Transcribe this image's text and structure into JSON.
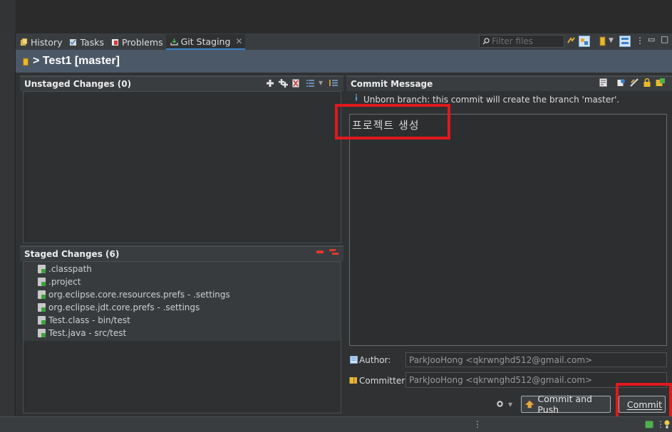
{
  "tabs": [
    {
      "label": "History",
      "icon": "history-icon"
    },
    {
      "label": "Tasks",
      "icon": "tasks-icon"
    },
    {
      "label": "Problems",
      "icon": "problems-icon"
    },
    {
      "label": "Git Staging",
      "icon": "git-staging-icon",
      "active": true
    }
  ],
  "filter": {
    "placeholder": "Filter files"
  },
  "repo": {
    "title": "> Test1 [master]"
  },
  "unstaged": {
    "title": "Unstaged Changes (0)"
  },
  "staged": {
    "title": "Staged Changes (6)",
    "files": [
      ".classpath",
      ".project",
      "org.eclipse.core.resources.prefs - .settings",
      "org.eclipse.jdt.core.prefs - .settings",
      "Test.class - bin/test",
      "Test.java - src/test"
    ]
  },
  "commit": {
    "title": "Commit Message",
    "info": "Unborn branch: this commit will create the branch 'master'.",
    "message": "프로젝트 생성",
    "author_label": "Author:",
    "author_value": "ParkJooHong <qkrwnghd512@gmail.com>",
    "committer_label": "Committer:",
    "committer_value": "ParkJooHong <qkrwnghd512@gmail.com>",
    "commit_push_label": "Commit and Push",
    "commit_label": "Commit"
  },
  "colors": {
    "highlight": "#e0191d",
    "repo_bar": "#4b5867",
    "accent": "#3d84c9"
  }
}
